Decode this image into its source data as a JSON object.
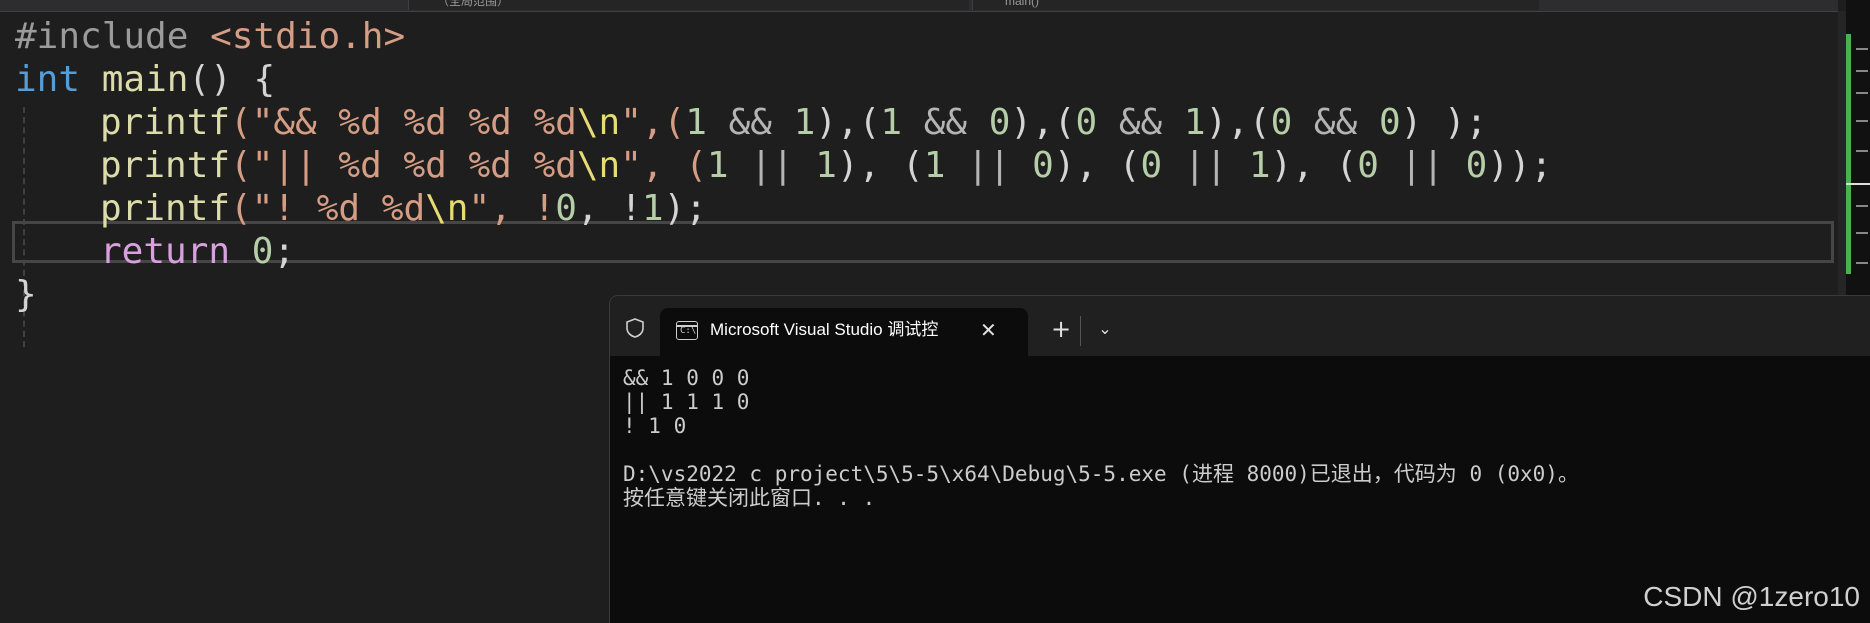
{
  "top_tabs": [
    "（全局范围）",
    "main()"
  ],
  "editor": {
    "lines": {
      "include": [
        "#include ",
        "<stdio.h>"
      ],
      "main_decl": [
        "int",
        " ",
        "main",
        "()",
        " {"
      ],
      "printf_and": [
        "printf",
        "(\"",
        "&& %d %d %d %d",
        "\\n",
        "\",(",
        "1",
        " && ",
        "1",
        "),(",
        "1",
        " && ",
        "0",
        "),(",
        "0",
        " && ",
        "1",
        "),(",
        "0",
        " && ",
        "0",
        ") );"
      ],
      "printf_or": [
        "printf",
        "(\"",
        "|| %d %d %d %d",
        "\\n",
        "\", (",
        "1",
        " || ",
        "1",
        "), (",
        "1",
        " || ",
        "0",
        "), (",
        "0",
        " || ",
        "1",
        "), (",
        "0",
        " || ",
        "0",
        "));"
      ],
      "printf_not": [
        "printf",
        "(\"",
        "! %d %d",
        "\\n",
        "\", !",
        "0",
        ", !",
        "1",
        ");"
      ],
      "return": [
        "return",
        " ",
        "0",
        ";"
      ],
      "close": "}"
    }
  },
  "terminal": {
    "tab_title": "Microsoft Visual Studio 调试控",
    "tab_icon_text": "C:\\",
    "close_glyph": "✕",
    "new_tab_glyph": "+",
    "dropdown_glyph": "⌄",
    "output": [
      "&& 1 0 0 0",
      "|| 1 1 1 0",
      "! 1 0",
      "",
      "D:\\vs2022 c project\\5\\5-5\\x64\\Debug\\5-5.exe (进程 8000)已退出，代码为 0 (0x0)。",
      "按任意键关闭此窗口. . ."
    ]
  },
  "watermark": "CSDN @1zero10",
  "colors": {
    "editor_bg": "#1e1e1e",
    "keyword": "#569cd6",
    "function": "#dcdcaa",
    "string": "#d69d85",
    "number": "#b5cea8",
    "control_keyword": "#d8a0df",
    "terminal_bg": "#0c0c0c",
    "minimap_green": "#4caf50"
  }
}
